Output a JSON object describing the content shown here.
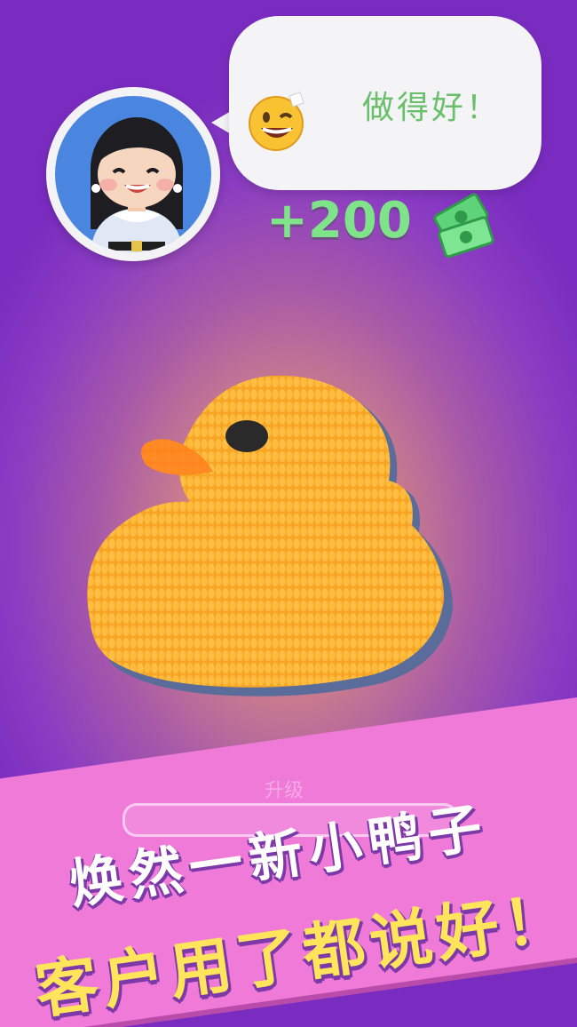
{
  "customer": {
    "avatar": "customer-girl-avatar",
    "speech": {
      "emoji": "winking-face-emoji",
      "text": "做得好！"
    }
  },
  "reward": {
    "amount_text": "+200",
    "icon": "cash-bills-icon",
    "color": "#7fe38a"
  },
  "item": {
    "name": "knitted-duck",
    "color": "#f6a624"
  },
  "progress": {
    "label": "升级",
    "value": 0.0
  },
  "banner": {
    "line1": "焕然一新小鸭子",
    "line2": "客户用了都说好！",
    "color": "#f07ad8",
    "line1_color": "#ffffff",
    "line2_color": "#ffe45c"
  }
}
